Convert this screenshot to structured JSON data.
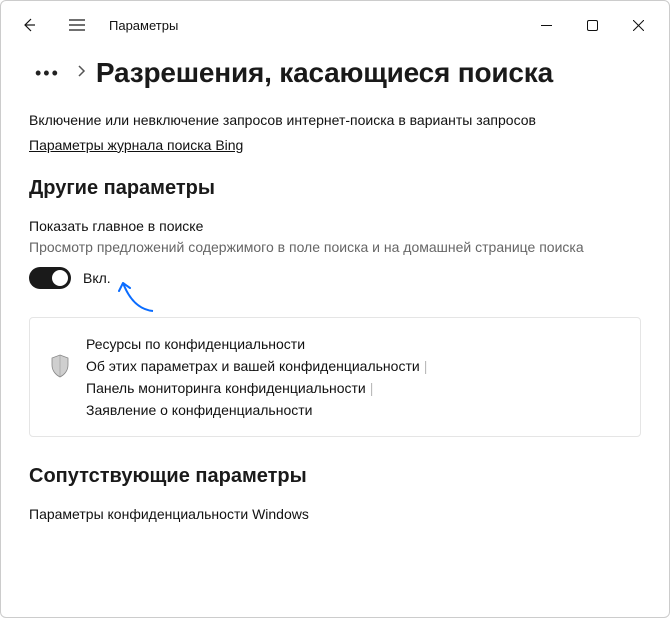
{
  "app": {
    "title": "Параметры"
  },
  "header": {
    "page_title": "Разрешения, касающиеся поиска"
  },
  "intro": {
    "desc": "Включение или невключение запросов интернет-поиска в варианты запросов",
    "link": "Параметры журнала поиска Bing"
  },
  "sections": {
    "other": {
      "title": "Другие параметры",
      "setting": {
        "title": "Показать главное в поиске",
        "desc": "Просмотр предложений содержимого в поле поиска и на домашней странице поиска",
        "state_label": "Вкл."
      }
    },
    "privacy_card": {
      "lines": [
        "Ресурсы по конфиденциальности",
        "Об этих параметрах и вашей конфиденциальности",
        "Панель мониторинга конфиденциальности",
        "Заявление о конфиденциальности"
      ]
    },
    "related": {
      "title": "Сопутствующие параметры",
      "link": "Параметры конфиденциальности Windows"
    }
  }
}
